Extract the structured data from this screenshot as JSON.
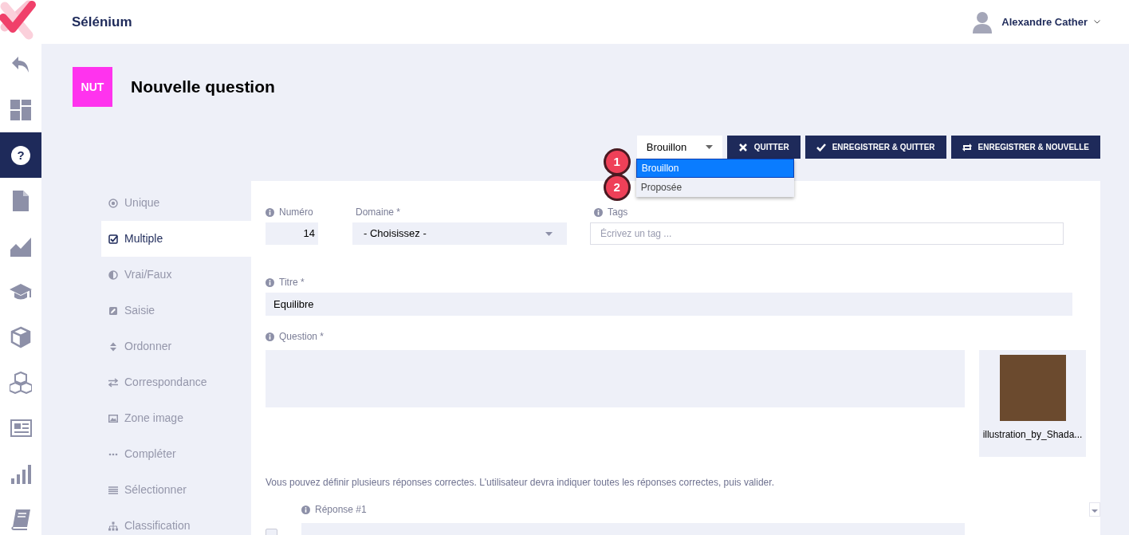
{
  "app": {
    "title": "Sélénium"
  },
  "user": {
    "name": "Alexandre Cather"
  },
  "nav_items": [
    {
      "kind": "back",
      "selected": false
    },
    {
      "kind": "dashboard",
      "selected": false
    },
    {
      "kind": "question",
      "glyph": "?",
      "selected": true
    },
    {
      "kind": "document",
      "selected": false
    },
    {
      "kind": "chart",
      "selected": false
    },
    {
      "kind": "graduation",
      "selected": false
    },
    {
      "kind": "cube",
      "selected": false
    },
    {
      "kind": "cubes",
      "selected": false
    },
    {
      "kind": "news",
      "selected": false
    },
    {
      "kind": "stats",
      "selected": false
    },
    {
      "kind": "book",
      "selected": false
    }
  ],
  "page": {
    "badge": "NUT",
    "title": "Nouvelle question"
  },
  "status_select": {
    "value": "Brouillon",
    "options": [
      {
        "label": "Brouillon",
        "selected": true
      },
      {
        "label": "Proposée",
        "selected": false
      }
    ]
  },
  "markers": [
    "1",
    "2"
  ],
  "buttons": [
    {
      "label": "QUITTER",
      "kind": "close"
    },
    {
      "label": "ENREGISTRER & QUITTER",
      "kind": "check"
    },
    {
      "label": "ENREGISTRER & NOUVELLE",
      "kind": "repeat"
    }
  ],
  "question_types": [
    {
      "label": "Unique",
      "kind": "radio",
      "selected": false
    },
    {
      "label": "Multiple",
      "kind": "checkbox",
      "selected": true
    },
    {
      "label": "Vrai/Faux",
      "kind": "halfcircle",
      "selected": false
    },
    {
      "label": "Saisie",
      "kind": "edit",
      "selected": false
    },
    {
      "label": "Ordonner",
      "kind": "sort",
      "selected": false
    },
    {
      "label": "Correspondance",
      "kind": "exchange",
      "selected": false
    },
    {
      "label": "Zone image",
      "kind": "image",
      "selected": false
    },
    {
      "label": "Compléter",
      "kind": "dots",
      "selected": false
    },
    {
      "label": "Sélectionner",
      "kind": "list",
      "selected": false
    },
    {
      "label": "Classification",
      "kind": "sitemap",
      "selected": false
    }
  ],
  "form": {
    "numero": {
      "label": "Numéro",
      "value": "14"
    },
    "domaine": {
      "label": "Domaine *",
      "value": "- Choisissez -"
    },
    "tags": {
      "label": "Tags",
      "placeholder": "Écrivez un tag ..."
    },
    "titre": {
      "label": "Titre *",
      "value": "Equilibre"
    },
    "question": {
      "label": "Question *"
    },
    "image": {
      "caption": "illustration_by_Shada..."
    },
    "hint": "Vous pouvez définir plusieurs réponses correctes. L'utilisateur devra indiquer toutes les réponses correctes, puis valider.",
    "answer": {
      "label": "Réponse #1",
      "checked": false
    }
  }
}
